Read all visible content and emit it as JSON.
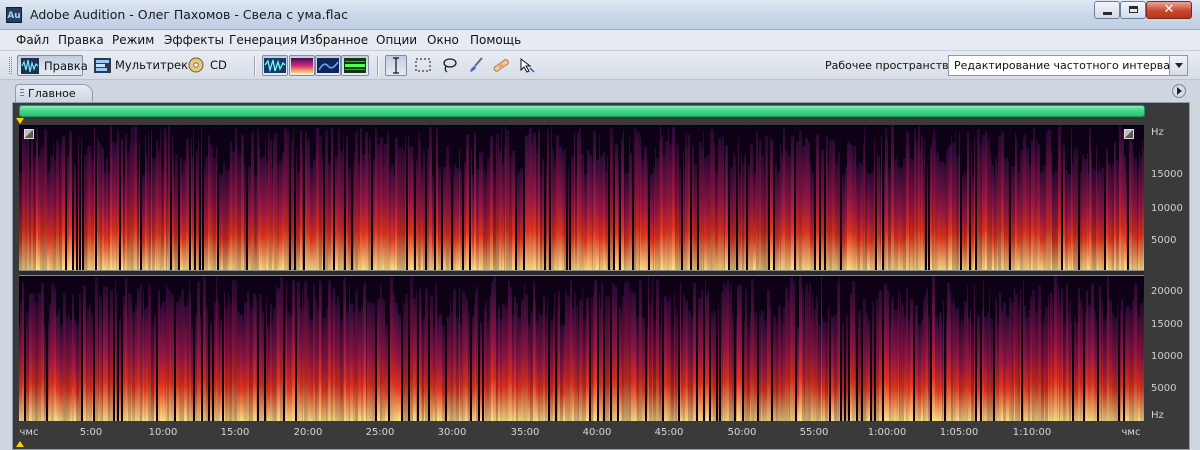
{
  "window": {
    "app_icon": "Au",
    "title": "Adobe Audition - Олег Пахомов - Свела с ума.flac",
    "close_glyph": "✕"
  },
  "menu": [
    {
      "label": "Файл"
    },
    {
      "label": "Правка"
    },
    {
      "label": "Режим"
    },
    {
      "label": "Эффекты"
    },
    {
      "label": "Генерация"
    },
    {
      "label": "Избранное"
    },
    {
      "label": "Опции"
    },
    {
      "label": "Окно"
    },
    {
      "label": "Помощь"
    }
  ],
  "toolbar": {
    "edit_label": "Правка",
    "multitrack_label": "Мультитрек",
    "cd_label": "CD",
    "workspace_label": "Рабочее пространство:",
    "workspace_value": "Редактирование частотного интервала",
    "view_modes": [
      "waveform-view-icon",
      "spectral-frequency-view-icon",
      "spectral-pan-view-icon",
      "spectral-phase-view-icon"
    ],
    "tools": [
      "time-selection-tool-icon",
      "marquee-tool-icon",
      "lasso-tool-icon",
      "brush-tool-icon",
      "spot-healing-tool-icon",
      "move-tool-icon"
    ]
  },
  "panel": {
    "tab_label": "Главное"
  },
  "colors": {
    "overview": "#3fd487",
    "playhead": "#ffd200",
    "spectrogram_low": "#ffe58a",
    "spectrogram_mid": "#e8341c",
    "spectrogram_high": "#2a0a3a"
  },
  "freq_ruler_top": [
    "Hz",
    "15000",
    "10000",
    "5000"
  ],
  "freq_ruler_bottom": [
    "20000",
    "15000",
    "10000",
    "5000",
    "Hz"
  ],
  "time_ruler": [
    "чмс",
    "5:00",
    "10:00",
    "15:00",
    "20:00",
    "25:00",
    "30:00",
    "35:00",
    "40:00",
    "45:00",
    "50:00",
    "55:00",
    "1:00:00",
    "1:05:00",
    "1:10:00",
    "чмс"
  ]
}
